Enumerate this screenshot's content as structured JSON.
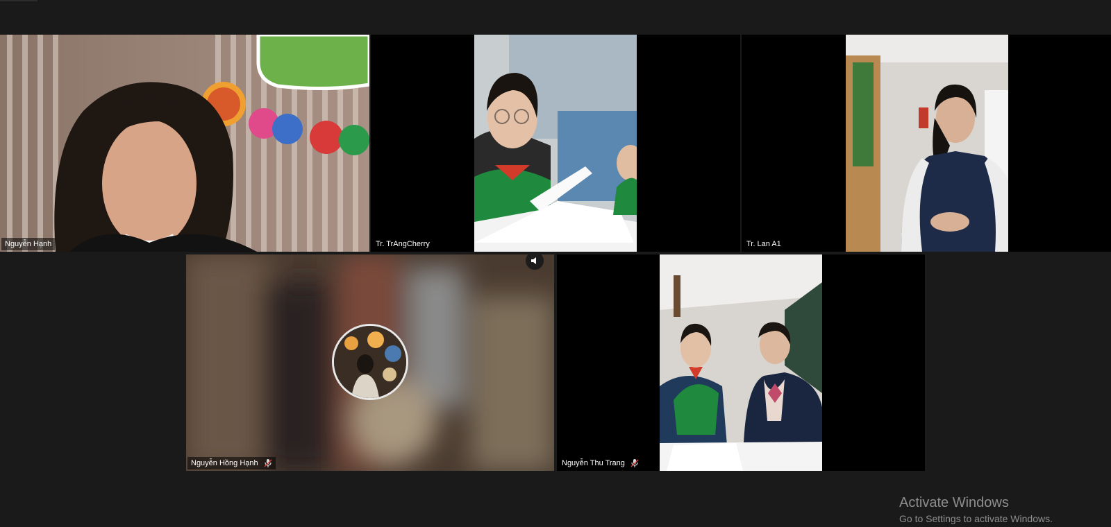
{
  "window": {
    "background": "#1a1a1a",
    "active_speaker_color": "#2a5db0"
  },
  "participants": [
    {
      "name": "Nguyễn Hạnh",
      "active_speaker": true,
      "muted": false
    },
    {
      "name": "Tr. TrAngCherry",
      "active_speaker": false,
      "muted": false
    },
    {
      "name": "Tr. Lan A1",
      "active_speaker": false,
      "muted": false
    },
    {
      "name": "Nguyễn Hồng Hạnh",
      "active_speaker": false,
      "muted": true,
      "audio_icon": "speaker-icon"
    },
    {
      "name": "Nguyễn Thu Trang",
      "active_speaker": false,
      "muted": true
    }
  ],
  "watermark": {
    "title": "Activate Windows",
    "subtitle": "Go to Settings to activate Windows."
  }
}
